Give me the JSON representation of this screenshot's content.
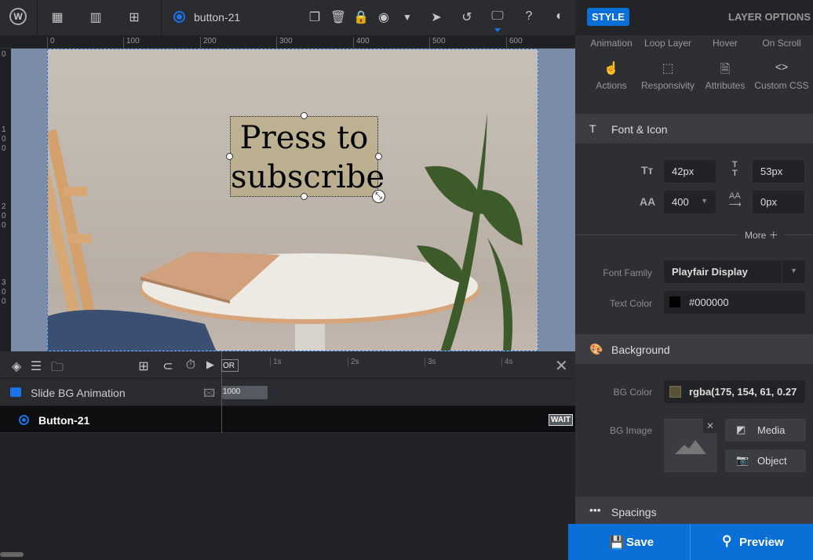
{
  "toolbar": {
    "layer_name": "button-21",
    "icons": [
      "wordpress-icon",
      "grid-icon",
      "library-icon",
      "add-slide-icon",
      "duplicate-icon",
      "delete-icon",
      "lock-icon",
      "visibility-icon",
      "dropdown-icon",
      "cursor-icon",
      "undo-icon",
      "desktop-icon",
      "help-icon",
      "contrast-icon"
    ]
  },
  "ruler": {
    "h": [
      "0",
      "100",
      "200",
      "300",
      "400",
      "500",
      "600"
    ],
    "v": [
      "0",
      "100",
      "200",
      "300"
    ]
  },
  "layer": {
    "text_line1": "Press to",
    "text_line2": "subscribe",
    "bg_color": "rgba(175, 154, 61, 0.27)"
  },
  "timeline": {
    "marker": "OR",
    "ticks": [
      "1s",
      "2s",
      "3s",
      "4s"
    ],
    "rows": [
      {
        "label": "Slide BG Animation",
        "duration": "1000"
      },
      {
        "label": "Button-21",
        "badge": "WAIT"
      }
    ]
  },
  "panel": {
    "style_label": "STYLE",
    "layer_options_label": "LAYER OPTIONS",
    "tabs_top": [
      "Animation",
      "Loop Layer",
      "Hover",
      "On Scroll"
    ],
    "tabs_bottom": [
      "Actions",
      "Responsivity",
      "Attributes",
      "Custom CSS"
    ],
    "font_section": {
      "title": "Font & Icon",
      "font_size": "42px",
      "line_height": "53px",
      "font_weight": "400",
      "letter_spacing": "0px",
      "more": "More",
      "font_family_label": "Font Family",
      "font_family": "Playfair Display",
      "text_color_label": "Text Color",
      "text_color": "#000000"
    },
    "background_section": {
      "title": "Background",
      "bg_color_label": "BG Color",
      "bg_color": "rgba(175, 154, 61, 0.27",
      "bg_image_label": "BG Image",
      "media": "Media",
      "object": "Object"
    },
    "spacings_title": "Spacings",
    "save": "Save",
    "preview": "Preview"
  },
  "colors": {
    "accent": "#0a6fd6",
    "canvas": "#7a8ca8",
    "swatch_bg": "#5a5238"
  }
}
